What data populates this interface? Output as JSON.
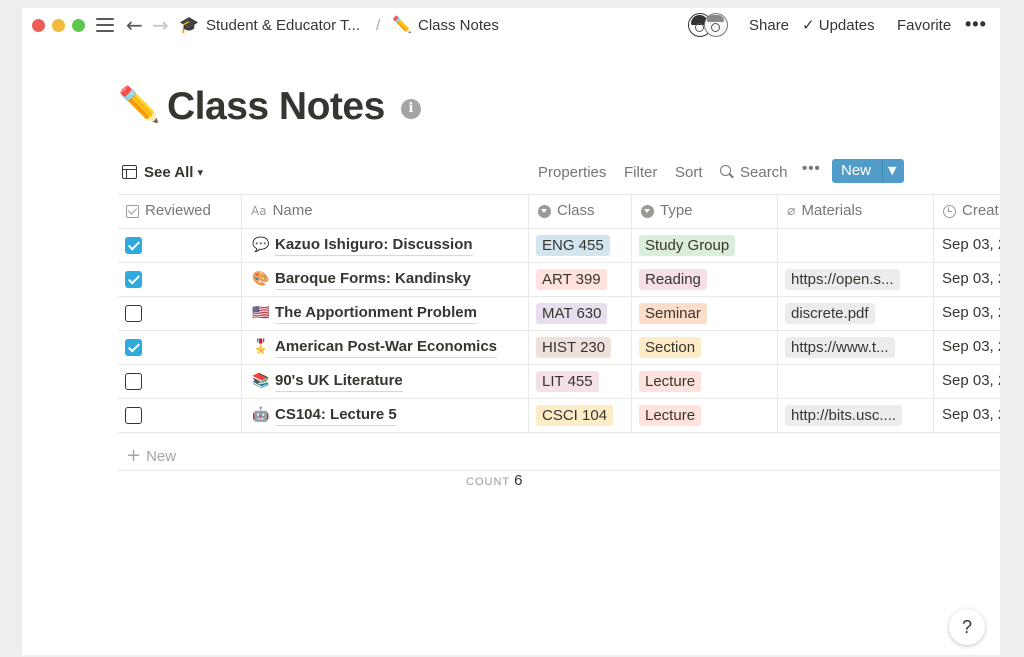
{
  "topbar": {
    "breadcrumb_parent_emoji": "🎓",
    "breadcrumb_parent": "Student & Educator T...",
    "breadcrumb_separator": "/",
    "breadcrumb_current_emoji": "✏️",
    "breadcrumb_current": "Class Notes",
    "share_label": "Share",
    "updates_label": "✓ Updates",
    "favorite_label": "Favorite",
    "more_label": "•••"
  },
  "page": {
    "emoji": "✏️",
    "title": "Class Notes",
    "info_glyph": "i"
  },
  "view": {
    "name": "See All",
    "properties_label": "Properties",
    "filter_label": "Filter",
    "sort_label": "Sort",
    "search_label": "Search",
    "more_label": "•••",
    "new_label": "New"
  },
  "table": {
    "columns": [
      {
        "label": "Reviewed",
        "icon": "checkbox-icon"
      },
      {
        "label": "Name",
        "icon": "text-aa-icon"
      },
      {
        "label": "Class",
        "icon": "select-icon"
      },
      {
        "label": "Type",
        "icon": "select-icon"
      },
      {
        "label": "Materials",
        "icon": "paperclip-icon"
      },
      {
        "label": "Creat",
        "icon": "clock-icon"
      }
    ],
    "rows": [
      {
        "reviewed": true,
        "emoji": "💬",
        "name": "Kazuo Ishiguro: Discussion",
        "class": "ENG 455",
        "class_color": "#d3e5ef",
        "type": "Study Group",
        "type_color": "#dbeddb",
        "materials": "",
        "created": "Sep 03, 2"
      },
      {
        "reviewed": true,
        "emoji": "🎨",
        "name": "Baroque Forms: Kandinsky",
        "class": "ART 399",
        "class_color": "#ffe2dd",
        "type": "Reading",
        "type_color": "#f5e0e9",
        "materials": "https://open.s...",
        "created": "Sep 03, 2"
      },
      {
        "reviewed": false,
        "emoji": "🇺🇸",
        "name": "The Apportionment Problem",
        "class": "MAT 630",
        "class_color": "#e8deee",
        "type": "Seminar",
        "type_color": "#fadec9",
        "materials": "discrete.pdf",
        "created": "Sep 03, 2"
      },
      {
        "reviewed": true,
        "emoji": "🎖️",
        "name": "American Post-War Economics",
        "class": "HIST 230",
        "class_color": "#eee0da",
        "type": "Section",
        "type_color": "#fdecc8",
        "materials": "https://www.t...",
        "created": "Sep 03, 2"
      },
      {
        "reviewed": false,
        "emoji": "📚",
        "name": "90's UK Literature",
        "class": "LIT 455",
        "class_color": "#f5e0e9",
        "type": "Lecture",
        "type_color": "#ffe2dd",
        "materials": "",
        "created": "Sep 03, 2"
      },
      {
        "reviewed": false,
        "emoji": "🤖",
        "name": "CS104: Lecture 5",
        "class": "CSCI 104",
        "class_color": "#fdecc8",
        "type": "Lecture",
        "type_color": "#ffe2dd",
        "materials": "http://bits.usc....",
        "created": "Sep 03, 2"
      }
    ],
    "new_row_label": "New",
    "count_label": "COUNT",
    "count_value": "6"
  },
  "help_label": "?",
  "colors": {
    "accent": "#529cca",
    "checkbox_checked": "#2eaadc"
  }
}
